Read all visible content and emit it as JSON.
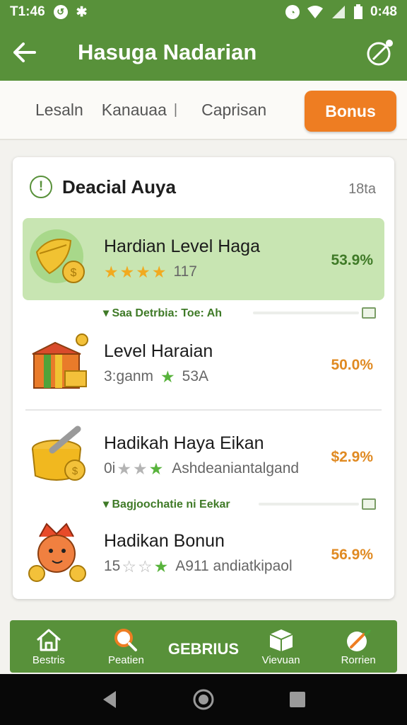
{
  "status_bar": {
    "time_left": "T1:46",
    "time_right": "0:48",
    "icons": [
      "notification-icon",
      "bluetooth-icon",
      "alarm-icon",
      "wifi-icon",
      "signal-icon",
      "battery-icon"
    ]
  },
  "app_bar": {
    "title": "Hasuga Nadarian",
    "back_icon": "arrow-left-icon",
    "action_icon": "edit-icon"
  },
  "tabs": {
    "items": [
      "Lesaln",
      "Kanauaa",
      "Caprisan"
    ],
    "separator": "|",
    "active": "Bonus"
  },
  "card": {
    "title": "Deacial Auya",
    "meta": "18ta",
    "rows": [
      {
        "name": "Hardian Level Haga",
        "sub": "117",
        "percent": "53.9%",
        "percent_color": "#3f7a27",
        "icon": "golden-leaf-coins-icon",
        "highlight": true
      },
      {
        "name": "Level Haraian",
        "sub_pre": "3:ganm",
        "sub_post": "53A",
        "percent": "50.0%",
        "percent_color": "#e08a22",
        "icon": "gift-box-icon"
      },
      {
        "name": "Hadikah Haya Eikan",
        "sub_pre": "0i",
        "sub_post": "Ashdeaniantalgand",
        "percent": "$2.9%",
        "percent_color": "#e08a22",
        "icon": "mortar-pot-icon"
      },
      {
        "name": "Hadikan Bonun",
        "sub_pre": "15",
        "sub_post": "A911 andiatkipaol",
        "percent": "56.9%",
        "percent_color": "#e08a22",
        "icon": "fox-mascot-icon"
      }
    ],
    "notes": [
      "Saa Detrbia: Toe: Ah",
      "Bagjoochatie ni Eekar"
    ]
  },
  "bottom_nav": {
    "items": [
      {
        "label": "Bestris",
        "icon": "home-icon"
      },
      {
        "label": "Peatien",
        "icon": "search-icon"
      },
      {
        "label": "Vievuan",
        "icon": "box-icon"
      },
      {
        "label": "Rorrien",
        "icon": "leaf-icon"
      }
    ],
    "center_label": "GEBRIUS"
  },
  "system_nav": {
    "icons": [
      "back-triangle-icon",
      "home-circle-icon",
      "recents-square-icon"
    ]
  },
  "colors": {
    "primary_green": "#58913a",
    "accent_orange": "#ee7d22",
    "highlight_green": "#c8e5b2",
    "star_gold": "#f1aa20"
  }
}
